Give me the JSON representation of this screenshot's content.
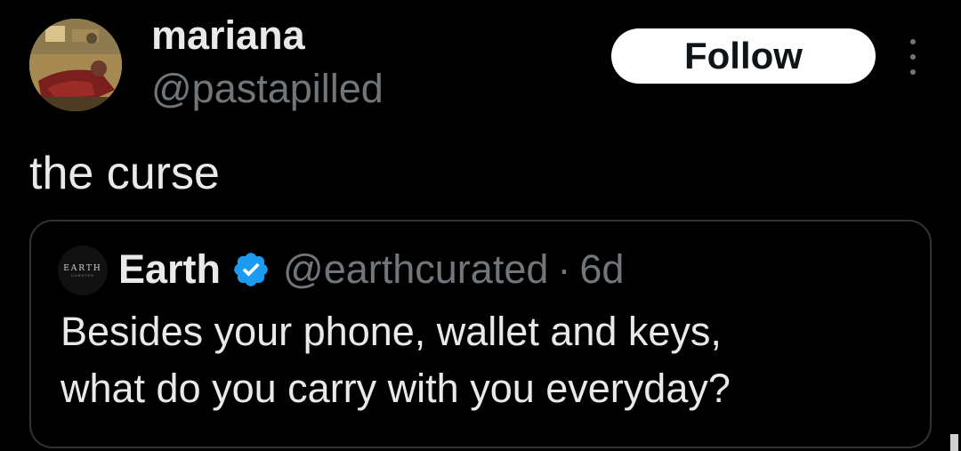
{
  "author": {
    "display_name": "mariana",
    "handle": "@pastapilled",
    "avatar_icon": "user-avatar-photo"
  },
  "follow_button": {
    "label": "Follow"
  },
  "more_menu": {
    "icon": "more-vertical-icon"
  },
  "tweet": {
    "text": "the curse"
  },
  "quoted_tweet": {
    "avatar_text": "EARTH",
    "avatar_subtext": "CURATED",
    "display_name": "Earth",
    "verified_icon": "verified-badge-icon",
    "handle": "@earthcurated",
    "separator": "·",
    "timestamp": "6d",
    "text_line_1": "Besides your phone, wallet and keys,",
    "text_line_2": "what do you carry with you everyday?"
  },
  "colors": {
    "background": "#000000",
    "primary_text": "#e7e9ea",
    "secondary_text": "#71767b",
    "border": "#2f3336",
    "verified_blue": "#1d9bf0",
    "follow_button_bg": "#ffffff"
  }
}
